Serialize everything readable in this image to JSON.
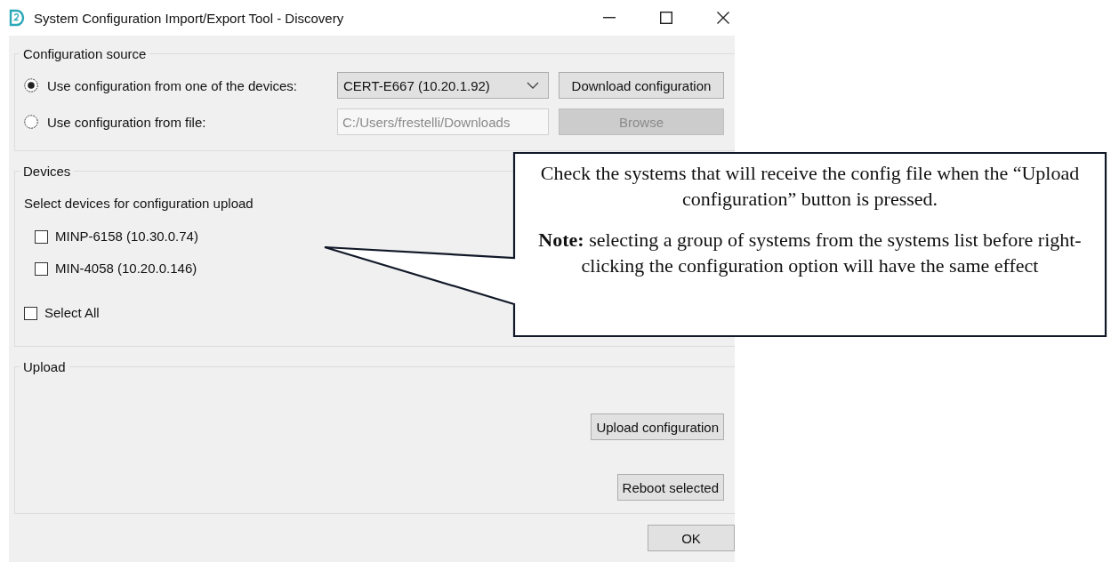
{
  "window": {
    "title": "System Configuration Import/Export Tool - Discovery"
  },
  "configuration_source": {
    "title": "Configuration source",
    "options": [
      {
        "label": "Use configuration from one of the devices:",
        "selected": true,
        "kind": "dropdown",
        "value": "CERT-E667 (10.20.1.92)",
        "disabled": false,
        "button": "Download configuration"
      },
      {
        "label": "Use configuration from file:",
        "selected": false,
        "kind": "field",
        "value": "C:/Users/frestelli/Downloads",
        "disabled": true,
        "button": "Browse"
      }
    ]
  },
  "devices": {
    "title": "Devices",
    "instruction": "Select devices for configuration upload",
    "items": [
      {
        "label": "MINP-6158 (10.30.0.74)",
        "checked": false
      },
      {
        "label": "MIN-4058 (10.20.0.146)",
        "checked": false
      }
    ],
    "select_all": {
      "label": "Select All",
      "checked": false
    }
  },
  "upload": {
    "title": "Upload",
    "buttons": [
      "Upload configuration",
      "Reboot selected"
    ]
  },
  "ok_button": "OK",
  "callout": {
    "paragraphs": [
      "Check the systems that will receive the config file when the “Upload configuration” button is pressed.",
      "**Note:** selecting a group of systems from the systems list before right-clicking the configuration option will have the same effect"
    ]
  }
}
